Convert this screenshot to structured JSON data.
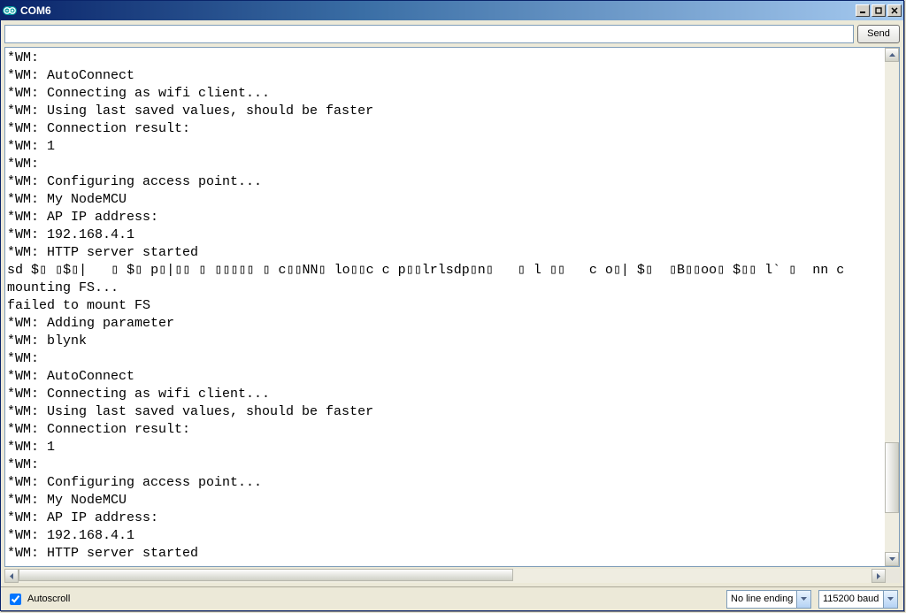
{
  "window": {
    "title": "COM6"
  },
  "toolbar": {
    "send_label": "Send",
    "input_value": ""
  },
  "console": {
    "lines": [
      "*WM:",
      "*WM: AutoConnect",
      "*WM: Connecting as wifi client...",
      "*WM: Using last saved values, should be faster",
      "*WM: Connection result:",
      "*WM: 1",
      "*WM:",
      "*WM: Configuring access point...",
      "*WM: My NodeMCU",
      "*WM: AP IP address:",
      "*WM: 192.168.4.1",
      "*WM: HTTP server started",
      "sd $▯ ▯$▯|   ▯ $▯ p▯|▯▯ ▯ ▯▯▯▯▯ ▯ c▯▯NN▯ lo▯▯c c p▯▯lrlsdp▯n▯   ▯ l ▯▯   c o▯| $▯  ▯B▯▯oo▯ $▯▯ l` ▯  nn c",
      "mounting FS...",
      "failed to mount FS",
      "*WM: Adding parameter",
      "*WM: blynk",
      "*WM:",
      "*WM: AutoConnect",
      "*WM: Connecting as wifi client...",
      "*WM: Using last saved values, should be faster",
      "*WM: Connection result:",
      "*WM: 1",
      "*WM:",
      "*WM: Configuring access point...",
      "*WM: My NodeMCU",
      "*WM: AP IP address:",
      "*WM: 192.168.4.1",
      "*WM: HTTP server started"
    ]
  },
  "footer": {
    "autoscroll_label": "Autoscroll",
    "autoscroll_checked": true,
    "line_ending_selected": "No line ending",
    "baud_selected": "115200 baud"
  }
}
